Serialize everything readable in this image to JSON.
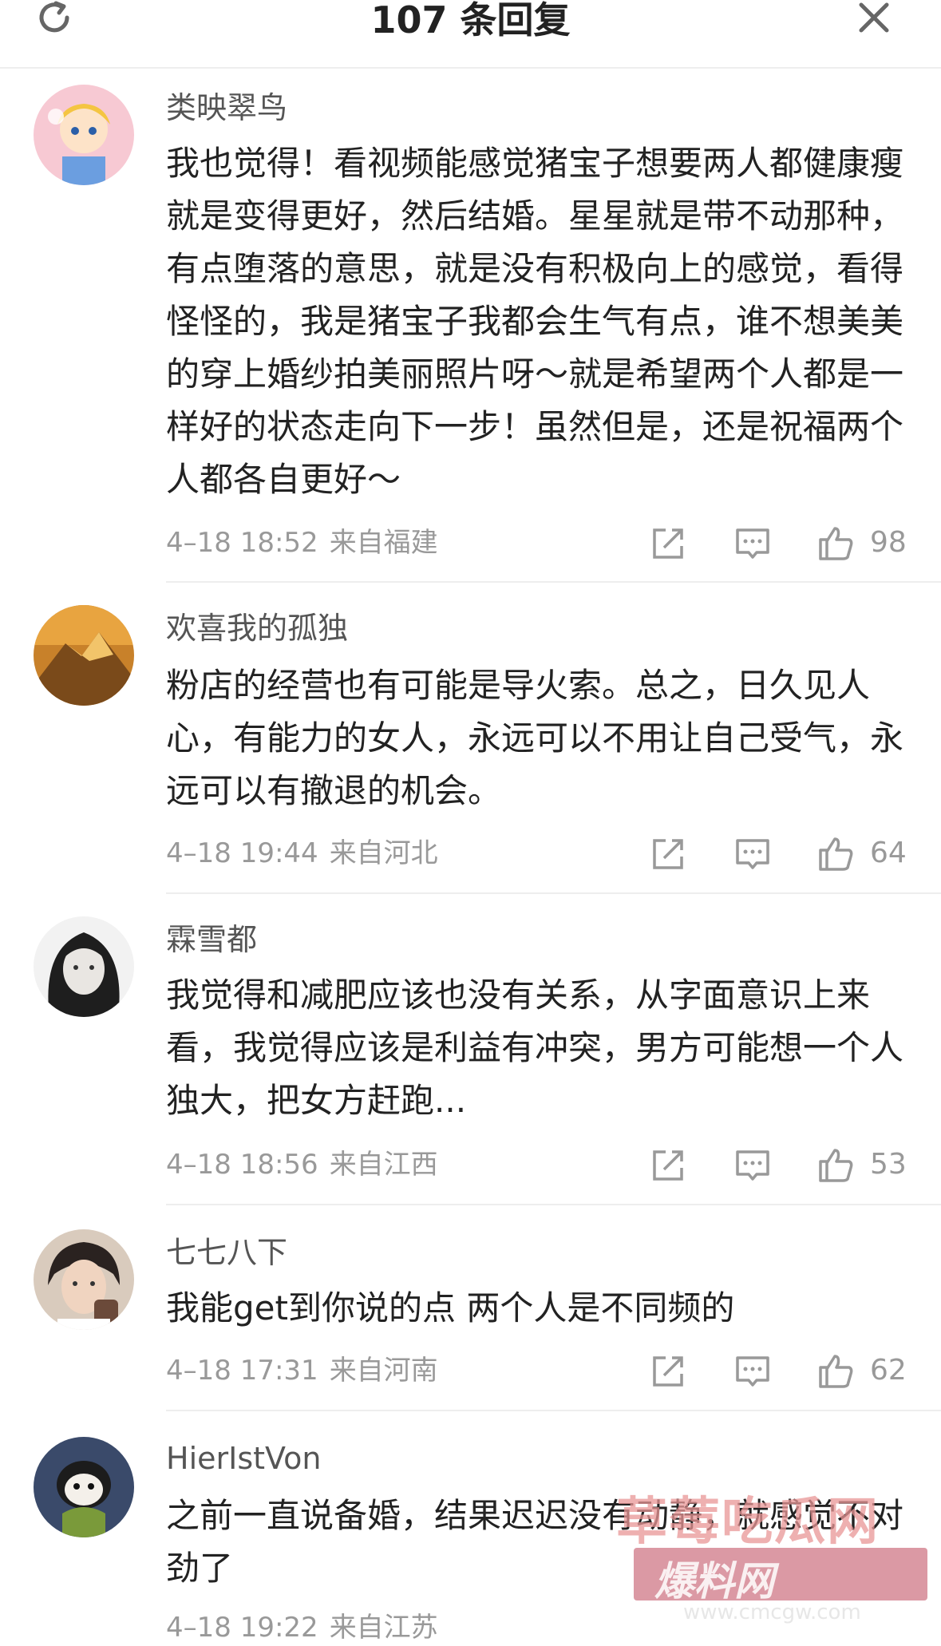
{
  "header": {
    "title": "107 条回复"
  },
  "comments": [
    {
      "user": "类映翠鸟",
      "body": "我也觉得！看视频能感觉猪宝子想要两人都健康瘦就是变得更好，然后结婚。星星就是带不动那种，有点堕落的意思，就是没有积极向上的感觉，看得怪怪的，我是猪宝子我都会生气有点，谁不想美美的穿上婚纱拍美丽照片呀～就是希望两个人都是一样好的状态走向下一步！虽然但是，还是祝福两个人都各自更好～",
      "time": "4–18 18:52",
      "location": "来自福建",
      "likes": "98"
    },
    {
      "user": "欢喜我的孤独",
      "body": "粉店的经营也有可能是导火索。总之，日久见人心，有能力的女人，永远可以不用让自己受气，永远可以有撤退的机会。",
      "time": "4–18 19:44",
      "location": "来自河北",
      "likes": "64"
    },
    {
      "user": "霖雪都",
      "body": "我觉得和减肥应该也没有关系，从字面意识上来看，我觉得应该是利益有冲突，男方可能想一个人独大，把女方赶跑...",
      "time": "4–18 18:56",
      "location": "来自江西",
      "likes": "53"
    },
    {
      "user": "七七八下",
      "body": "我能get到你说的点 两个人是不同频的",
      "time": "4–18 17:31",
      "location": "来自河南",
      "likes": "62"
    },
    {
      "user": "HierIstVon",
      "body": "之前一直说备婚，结果迟迟没有动静，就感觉不对劲了",
      "time": "4–18 19:22",
      "location": "来自江苏",
      "likes": ""
    }
  ],
  "watermark": {
    "line1": "草莓吃瓜网",
    "line2": "爆料网",
    "url": "www.cmcgw.com"
  },
  "colors": {
    "text": "#222222",
    "meta": "#999999",
    "divider": "#eeeeee"
  }
}
